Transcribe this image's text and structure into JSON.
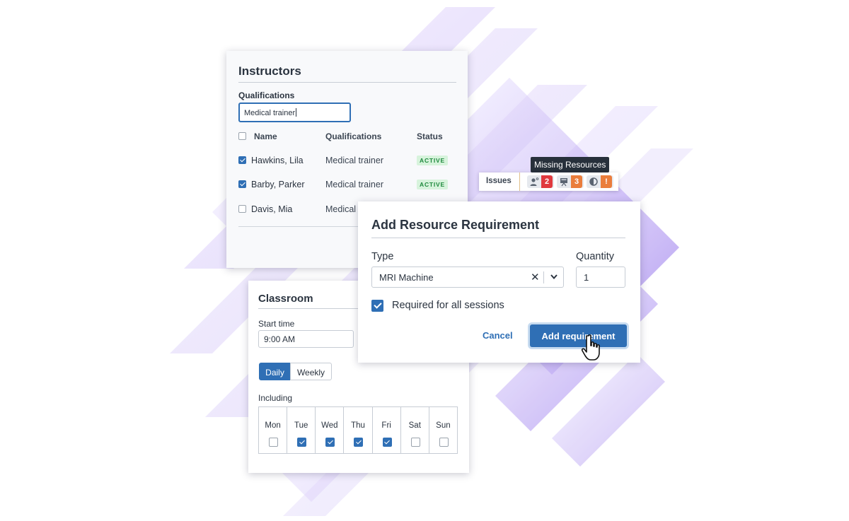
{
  "instructors": {
    "title": "Instructors",
    "qualifications_label": "Qualifications",
    "filter_value": "Medical trainer",
    "columns": {
      "name": "Name",
      "qualifications": "Qualifications",
      "status": "Status"
    },
    "rows": [
      {
        "name": "Hawkins, Lila",
        "qualification": "Medical trainer",
        "status": "ACTIVE",
        "checked": true
      },
      {
        "name": "Barby, Parker",
        "qualification": "Medical trainer",
        "status": "ACTIVE",
        "checked": true
      },
      {
        "name": "Davis, Mia",
        "qualification": "Medical",
        "status": "",
        "checked": false
      }
    ]
  },
  "classroom": {
    "title": "Classroom",
    "start_time_label": "Start time",
    "start_time_value": "9:00 AM",
    "frequency": {
      "daily": "Daily",
      "weekly": "Weekly",
      "selected": "Daily"
    },
    "including_label": "Including",
    "days": [
      {
        "name": "Mon",
        "checked": false
      },
      {
        "name": "Tue",
        "checked": true
      },
      {
        "name": "Wed",
        "checked": true
      },
      {
        "name": "Thu",
        "checked": true
      },
      {
        "name": "Fri",
        "checked": true
      },
      {
        "name": "Sat",
        "checked": false
      },
      {
        "name": "Sun",
        "checked": false
      }
    ]
  },
  "dialog": {
    "title": "Add Resource Requirement",
    "type_label": "Type",
    "type_value": "MRI Machine",
    "quantity_label": "Quantity",
    "quantity_value": "1",
    "required_label": "Required for all sessions",
    "required_checked": true,
    "cancel_label": "Cancel",
    "submit_label": "Add requirement"
  },
  "issues": {
    "label": "Issues",
    "tooltip": "Missing Resources",
    "chips": [
      {
        "icon": "person-icon",
        "count": "2",
        "color": "#e0393e"
      },
      {
        "icon": "presentation-board-icon",
        "count": "3",
        "color": "#ea7d3c"
      },
      {
        "icon": "half-circle-icon",
        "count": "!",
        "color": "#ea7d3c"
      }
    ]
  },
  "colors": {
    "accent": "#2f6fb5",
    "active_badge": "#1f8a3e",
    "background_stripes": "#8f6fe8"
  }
}
